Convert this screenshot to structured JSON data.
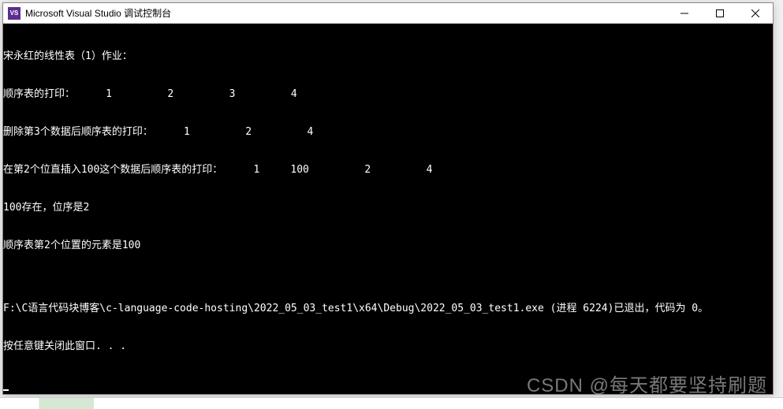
{
  "window": {
    "icon_text": "VS",
    "title": "Microsoft Visual Studio 调试控制台"
  },
  "console": {
    "lines": [
      "宋永红的线性表（1）作业：",
      "顺序表的打印：     1         2         3         4",
      "删除第3个数据后顺序表的打印：     1         2         4",
      "在第2个位直插入100这个数据后顺序表的打印：     1     100         2         4",
      "100存在，位序是2",
      "顺序表第2个位置的元素是100",
      "",
      "F:\\C语言代码块博客\\c-language-code-hosting\\2022_05_03_test1\\x64\\Debug\\2022_05_03_test1.exe (进程 6224)已退出，代码为 0。",
      "按任意键关闭此窗口. . ."
    ]
  },
  "watermark": "CSDN @每天都要坚持刷题"
}
